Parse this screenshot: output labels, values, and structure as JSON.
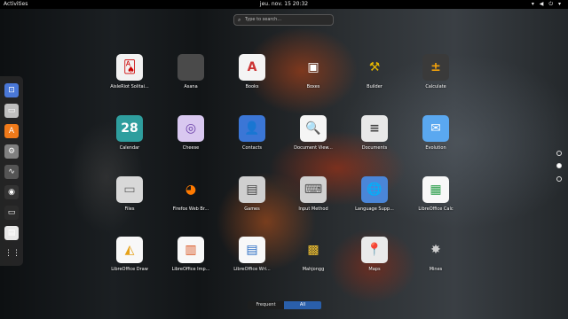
{
  "topbar": {
    "activities": "Activities",
    "clock": "jeu. nov. 15  20:32",
    "tray_icons": [
      "network-icon",
      "volume-icon",
      "power-icon",
      "menu-arrow-icon"
    ],
    "tray_text": "▾ ◀ ⏻ ▾"
  },
  "search": {
    "placeholder": "Type to search…"
  },
  "dash": [
    {
      "name": "dash-item-gnome-disks",
      "glyph": "⊡",
      "bg": "#4a78d8"
    },
    {
      "name": "dash-item-files",
      "glyph": "▭",
      "bg": "#bfbfbf"
    },
    {
      "name": "dash-item-software",
      "glyph": "A",
      "bg": "#f07a1a"
    },
    {
      "name": "dash-item-settings",
      "glyph": "⚙",
      "bg": "#808080"
    },
    {
      "name": "dash-item-system-monitor",
      "glyph": "∿",
      "bg": "#555"
    },
    {
      "name": "dash-item-obs",
      "glyph": "◉",
      "bg": "#333"
    },
    {
      "name": "dash-item-terminal",
      "glyph": "▭",
      "bg": "#2b2b2b"
    },
    {
      "name": "dash-item-libreoffice-calc",
      "glyph": "▤",
      "bg": "#e8e8e8"
    },
    {
      "name": "dash-item-show-applications",
      "glyph": "⋮⋮",
      "bg": "transparent"
    }
  ],
  "apps": [
    {
      "label": "AisleRiot Solitai...",
      "glyph": "🂡",
      "bg": "#f2f2f2",
      "color": "#c00"
    },
    {
      "label": "Asana",
      "glyph": "",
      "bg": "#4a4a4a",
      "color": "#fff"
    },
    {
      "label": "Books",
      "glyph": "A",
      "bg": "#f4f4f4",
      "color": "#c33"
    },
    {
      "label": "Boxes",
      "glyph": "▣",
      "bg": "transparent",
      "color": "#fff"
    },
    {
      "label": "Builder",
      "glyph": "⚒",
      "bg": "transparent",
      "color": "#e6b800"
    },
    {
      "label": "Calculate",
      "glyph": "±",
      "bg": "#3a3a3a",
      "color": "#f2a10b"
    },
    {
      "label": "Calendar",
      "glyph": "28",
      "bg": "#2e9e9e",
      "color": "#fff"
    },
    {
      "label": "Cheese",
      "glyph": "◎",
      "bg": "#d9c8f0",
      "color": "#6a3fa8"
    },
    {
      "label": "Contacts",
      "glyph": "👤",
      "bg": "#3b76d6",
      "color": "#fff"
    },
    {
      "label": "Document View...",
      "glyph": "🔍",
      "bg": "#f5f5f5",
      "color": "#333"
    },
    {
      "label": "Documents",
      "glyph": "≡",
      "bg": "#e8e8e8",
      "color": "#444"
    },
    {
      "label": "Evolution",
      "glyph": "✉",
      "bg": "#5aa8f0",
      "color": "#fff"
    },
    {
      "label": "Files",
      "glyph": "▭",
      "bg": "#d8d8d8",
      "color": "#666"
    },
    {
      "label": "Firefox Web Br...",
      "glyph": "◕",
      "bg": "transparent",
      "color": "#ff7a00"
    },
    {
      "label": "Games",
      "glyph": "▤",
      "bg": "#cfcfcf",
      "color": "#444"
    },
    {
      "label": "Input Method",
      "glyph": "⌨",
      "bg": "#d0d0d0",
      "color": "#555"
    },
    {
      "label": "Language Supp...",
      "glyph": "🌐",
      "bg": "#4a86d8",
      "color": "#fff"
    },
    {
      "label": "LibreOffice Calc",
      "glyph": "▦",
      "bg": "#f8f8f8",
      "color": "#2a9d4a"
    },
    {
      "label": "LibreOffice Draw",
      "glyph": "◭",
      "bg": "#f8f8f8",
      "color": "#e6a21a"
    },
    {
      "label": "LibreOffice Imp...",
      "glyph": "▥",
      "bg": "#f8f8f8",
      "color": "#d9531e"
    },
    {
      "label": "LibreOffice Wri...",
      "glyph": "▤",
      "bg": "#f8f8f8",
      "color": "#2a6dc4"
    },
    {
      "label": "Mahjongg",
      "glyph": "▩",
      "bg": "transparent",
      "color": "#f2c230"
    },
    {
      "label": "Maps",
      "glyph": "📍",
      "bg": "#eaeaea",
      "color": "#d33"
    },
    {
      "label": "Mines",
      "glyph": "✸",
      "bg": "transparent",
      "color": "#ccc"
    }
  ],
  "tabs": {
    "frequent": "Frequent",
    "all": "All"
  }
}
